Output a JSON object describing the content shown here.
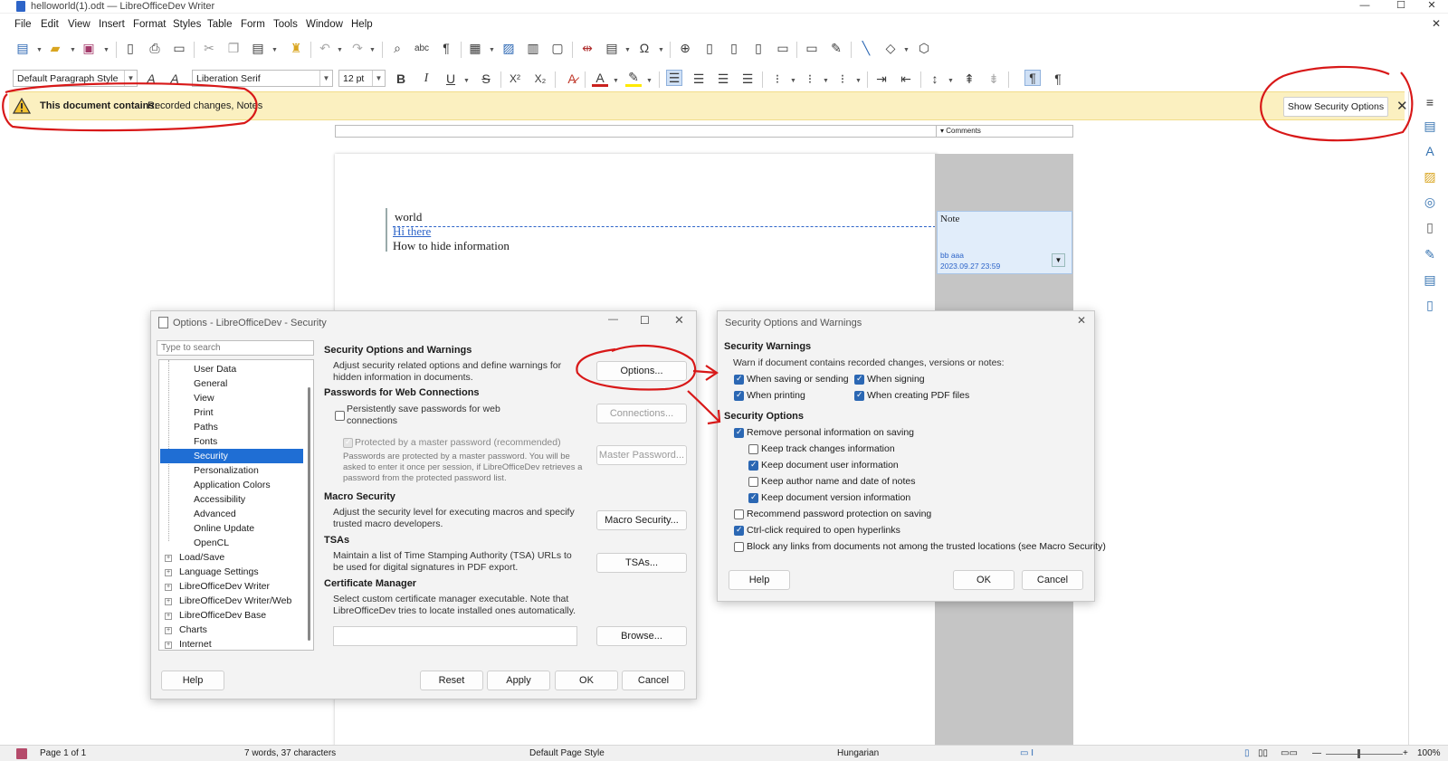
{
  "window": {
    "title": "helloworld(1).odt — LibreOfficeDev Writer"
  },
  "menu": [
    "File",
    "Edit",
    "View",
    "Insert",
    "Format",
    "Styles",
    "Table",
    "Form",
    "Tools",
    "Window",
    "Help"
  ],
  "formatting": {
    "paragraph_style": "Default Paragraph Style",
    "font_name": "Liberation Serif",
    "font_size": "12 pt",
    "bold": "B",
    "italic": "I",
    "underline": "U",
    "strike": "S"
  },
  "infobar": {
    "label": "This document contains:",
    "value": "Recorded changes, Notes",
    "button": "Show Security Options"
  },
  "ruler": {
    "comments": "Comments"
  },
  "document": {
    "lines": [
      "world",
      "Hi there",
      "How to hide information"
    ]
  },
  "note": {
    "title": "Note",
    "author": "bb aaa",
    "date": "2023.09.27 23:59"
  },
  "options_dialog": {
    "title": "Options - LibreOfficeDev - Security",
    "search_placeholder": "Type to search",
    "tree_children": [
      "User Data",
      "General",
      "View",
      "Print",
      "Paths",
      "Fonts",
      "Security",
      "Personalization",
      "Application Colors",
      "Accessibility",
      "Advanced",
      "Online Update",
      "OpenCL"
    ],
    "tree_roots": [
      "Load/Save",
      "Language Settings",
      "LibreOfficeDev Writer",
      "LibreOfficeDev Writer/Web",
      "LibreOfficeDev Base",
      "Charts",
      "Internet"
    ],
    "selected": "Security",
    "sec_opts_heading": "Security Options and Warnings",
    "sec_opts_text": "Adjust security related options and define warnings for hidden information in documents.",
    "options_btn": "Options...",
    "passwords_heading": "Passwords for Web Connections",
    "persist_label": "Persistently save passwords for web connections",
    "master_label": "Protected by a master password (recommended)",
    "master_note": "Passwords are protected by a master password. You will be asked to enter it once per session, if LibreOfficeDev retrieves a password from the protected password list.",
    "connections_btn": "Connections...",
    "master_btn": "Master Password...",
    "macro_heading": "Macro Security",
    "macro_text": "Adjust the security level for executing macros and specify trusted macro developers.",
    "macro_btn": "Macro Security...",
    "tsa_heading": "TSAs",
    "tsa_text": "Maintain a list of Time Stamping Authority (TSA) URLs to be used for digital signatures in PDF export.",
    "tsa_btn": "TSAs...",
    "cert_heading": "Certificate Manager",
    "cert_text": "Select custom certificate manager executable. Note that LibreOfficeDev tries to locate installed ones automatically.",
    "cert_value": "",
    "browse_btn": "Browse...",
    "help": "Help",
    "reset": "Reset",
    "apply": "Apply",
    "ok": "OK",
    "cancel": "Cancel"
  },
  "security_dialog": {
    "title": "Security Options and Warnings",
    "warnings_heading": "Security Warnings",
    "warnings_text": "Warn if document contains recorded changes, versions or notes:",
    "w_saving": "When saving or sending",
    "w_signing": "When signing",
    "w_printing": "When printing",
    "w_pdf": "When creating PDF files",
    "options_heading": "Security Options",
    "remove_personal": "Remove personal information on saving",
    "keep_track": "Keep track changes information",
    "keep_user": "Keep document user information",
    "keep_author": "Keep author name and date of notes",
    "keep_version": "Keep document version information",
    "recommend_pw": "Recommend password protection on saving",
    "ctrl_click": "Ctrl-click required to open hyperlinks",
    "block_links": "Block any links from documents not among the trusted locations (see Macro Security)",
    "help": "Help",
    "ok": "OK",
    "cancel": "Cancel"
  },
  "status": {
    "page": "Page 1 of 1",
    "words": "7 words, 37 characters",
    "page_style": "Default Page Style",
    "language": "Hungarian",
    "zoom": "100%"
  },
  "colors": {
    "accent": "#2b67b3",
    "infobar": "#fbf0c0",
    "annotation": "#d81818"
  }
}
